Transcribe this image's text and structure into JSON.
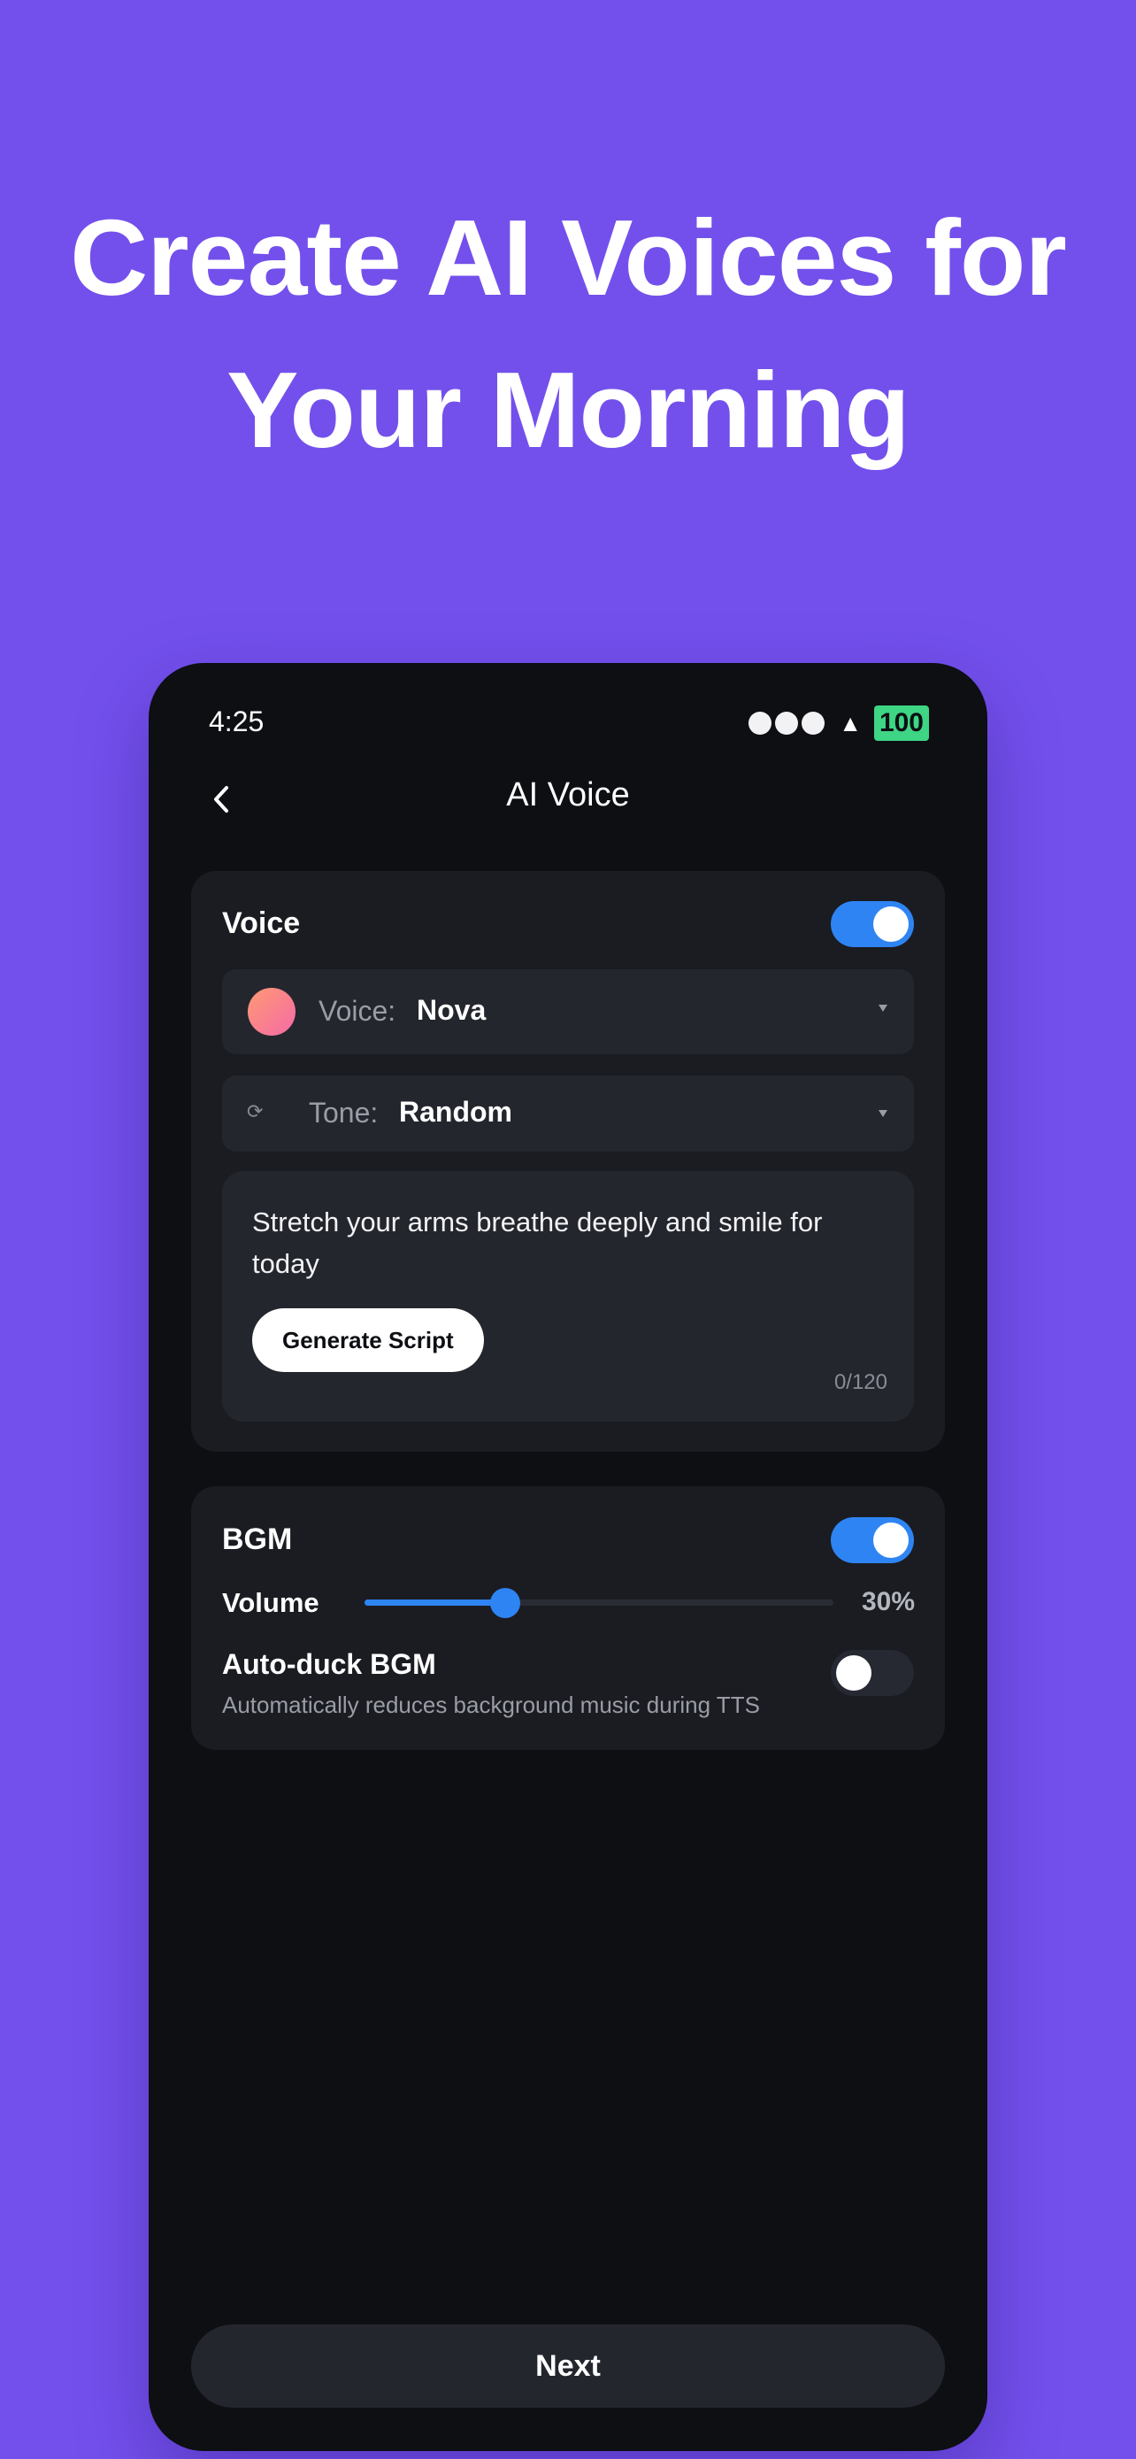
{
  "hero": {
    "line1": "Create AI Voices for",
    "line2": "Your Morning"
  },
  "status_bar": {
    "time": "4:25",
    "battery": "100",
    "battery_color": "#3ed585"
  },
  "nav": {
    "back_icon": "chevron-left-icon",
    "title": "AI Voice"
  },
  "voice_card": {
    "heading": "Voice",
    "enabled": true,
    "voice_label": "Voice:",
    "voice_value": "Nova",
    "tone_label": "Tone:",
    "tone_value": "Random",
    "tone_icon": "shuffle-icon",
    "script_text": "Stretch your arms breathe deeply and smile for today",
    "generate_label": "Generate Script",
    "counter": "0/120"
  },
  "bgm_card": {
    "heading": "BGM",
    "enabled": true,
    "volume_label": "Volume",
    "volume_percent": 30,
    "volume_text": "30%",
    "autoduck_title": "Auto-duck BGM",
    "autoduck_desc": "Automatically reduces background music during TTS",
    "autoduck_enabled": false
  },
  "footer": {
    "next_label": "Next"
  },
  "colors": {
    "background": "#7350ec",
    "accent": "#2f84f3",
    "surface": "#1a1c22"
  }
}
